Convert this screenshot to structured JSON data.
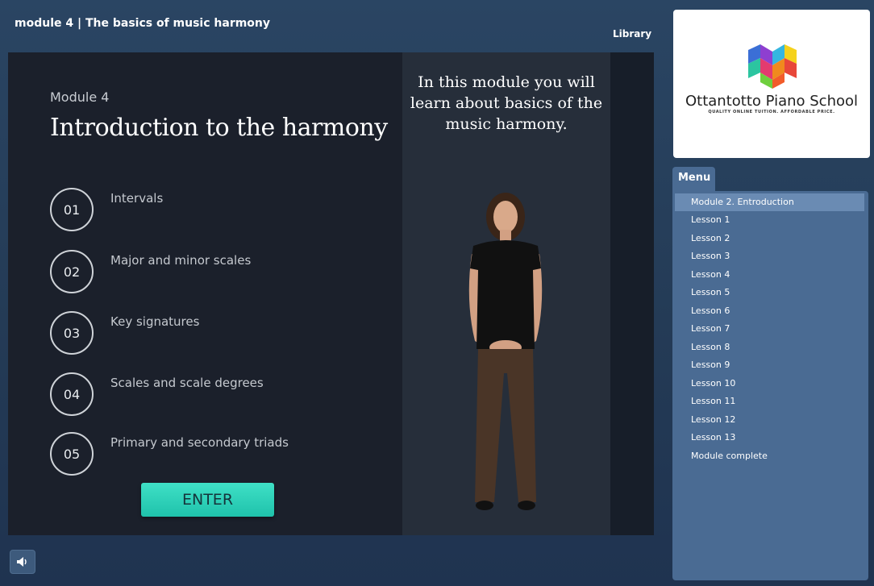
{
  "header": {
    "title": "module 4 | The basics of music harmony",
    "library_label": "Library"
  },
  "slide": {
    "module_label": "Module 4",
    "title": "Introduction to the harmony",
    "topics": [
      {
        "number": "01",
        "label": "Intervals"
      },
      {
        "number": "02",
        "label": "Major and minor scales"
      },
      {
        "number": "03",
        "label": "Key signatures"
      },
      {
        "number": "04",
        "label": "Scales and scale degrees"
      },
      {
        "number": "05",
        "label": "Primary and secondary triads"
      }
    ],
    "enter_label": "ENTER",
    "caption": "In this module you will learn about basics of the music harmony."
  },
  "logo": {
    "name": "Ottantotto Piano School",
    "tagline": "QUALITY ONLINE TUITION. AFFORDABLE PRICE."
  },
  "menu": {
    "tab_label": "Menu",
    "items": [
      {
        "label": "Module 2. Entroduction",
        "active": true
      },
      {
        "label": "Lesson 1"
      },
      {
        "label": "Lesson 2"
      },
      {
        "label": "Lesson 3"
      },
      {
        "label": "Lesson 4"
      },
      {
        "label": "Lesson 5"
      },
      {
        "label": "Lesson 6"
      },
      {
        "label": "Lesson 7"
      },
      {
        "label": "Lesson 8"
      },
      {
        "label": "Lesson 9"
      },
      {
        "label": "Lesson 10"
      },
      {
        "label": "Lesson 11"
      },
      {
        "label": "Lesson 12"
      },
      {
        "label": "Lesson 13"
      },
      {
        "label": "Module complete"
      }
    ]
  },
  "icons": {
    "sound": "speaker-icon"
  },
  "colors": {
    "accent": "#2fd1b8",
    "menu_bg": "#4a6b93",
    "menu_active": "#6a8bb3"
  }
}
